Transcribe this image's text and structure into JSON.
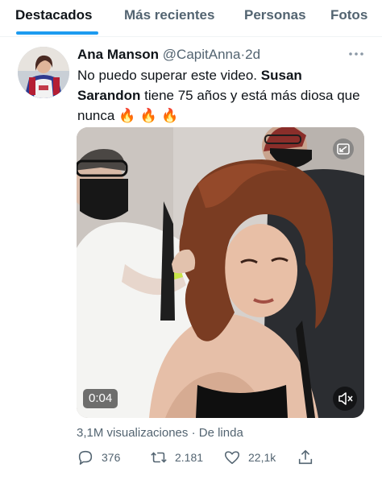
{
  "tabs": [
    {
      "label": "Destacados",
      "active": true
    },
    {
      "label": "Más recientes",
      "active": false
    },
    {
      "label": "Personas",
      "active": false
    },
    {
      "label": "Fotos",
      "active": false
    }
  ],
  "tweet": {
    "display_name": "Ana Manson",
    "handle": "@CapitAnna",
    "separator": "·",
    "time": "2d",
    "text_before": "No puedo superar este video. ",
    "text_bold": "Susan Sarandon",
    "text_after": " tiene 75 años y está más diosa que nunca ",
    "emojis": "🔥 🔥 🔥",
    "media": {
      "duration": "0:04",
      "top_icon": "picture-in-picture-icon",
      "mute_icon": "speaker-muted-icon"
    },
    "views": "3,1M visualizaciones",
    "source_sep": "·",
    "source": "De linda"
  },
  "actions": {
    "replies": "376",
    "retweets": "2.181",
    "likes": "22,1k"
  },
  "colors": {
    "accent": "#1d9bf0",
    "text": "#0f1419",
    "secondary": "#536471"
  }
}
